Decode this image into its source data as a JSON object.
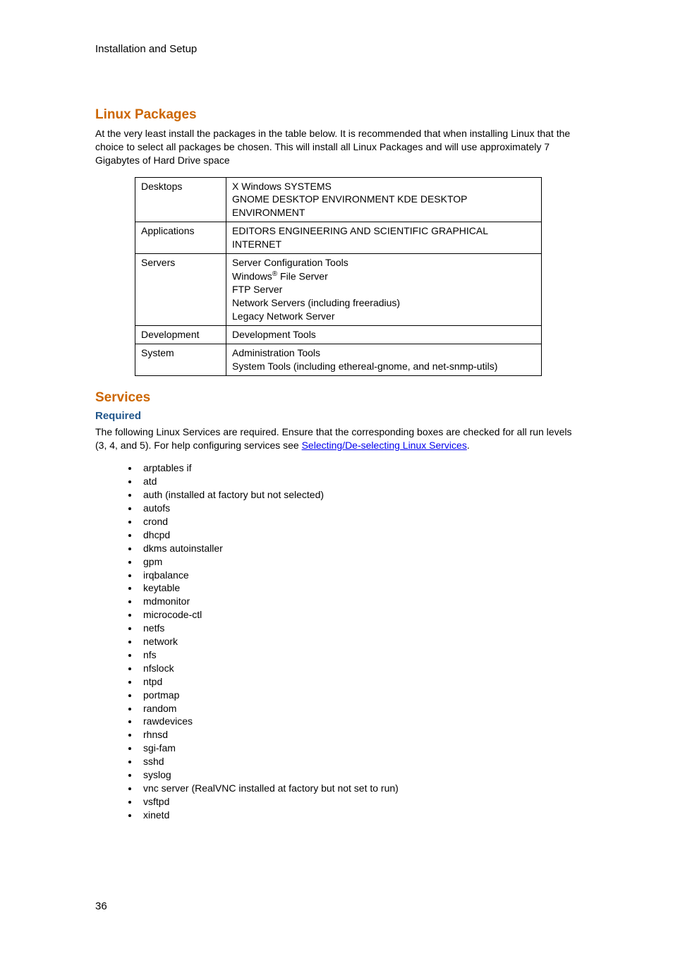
{
  "header": "Installation and Setup",
  "section1": {
    "title": "Linux Packages",
    "intro": "At the very least install the packages in the table below. It is recommended that when installing Linux that the choice to select all packages be chosen. This will install all Linux Packages and will use approximately 7 Gigabytes of Hard Drive space"
  },
  "table": {
    "rows": [
      {
        "cat": "Desktops",
        "val": "X Windows SYSTEMS\nGNOME DESKTOP ENVIRONMENT KDE DESKTOP ENVIRONMENT"
      },
      {
        "cat": "Applications",
        "val": "EDITORS ENGINEERING AND SCIENTIFIC GRAPHICAL INTERNET"
      },
      {
        "cat": "Servers",
        "val_pre": "Server Configuration Tools\nWindows",
        "val_sup": "®",
        "val_post": " File Server\nFTP Server\nNetwork Servers (including freeradius)\nLegacy Network Server"
      },
      {
        "cat": "Development",
        "val": "Development Tools"
      },
      {
        "cat": "System",
        "val": "Administration Tools\nSystem Tools (including ethereal-gnome, and net-snmp-utils)"
      }
    ]
  },
  "section2": {
    "title": "Services",
    "subtitle": "Required",
    "intro_pre": "The following Linux Services are required. Ensure that the corresponding boxes are checked for all run levels (3, 4, and 5). For help configuring services see ",
    "link": "Selecting/De-selecting Linux Services",
    "intro_post": "."
  },
  "services": [
    "arptables if",
    "atd",
    "auth (installed at factory but not selected)",
    "autofs",
    "crond",
    "dhcpd",
    "dkms autoinstaller",
    "gpm",
    "irqbalance",
    "keytable",
    "mdmonitor",
    "microcode-ctl",
    "netfs",
    "network",
    "nfs",
    "nfslock",
    "ntpd",
    "portmap",
    "random",
    "rawdevices",
    "rhnsd",
    "sgi-fam",
    "sshd",
    "syslog",
    "vnc server (RealVNC installed at factory but not set to run)",
    "vsftpd",
    "xinetd"
  ],
  "page_number": "36"
}
